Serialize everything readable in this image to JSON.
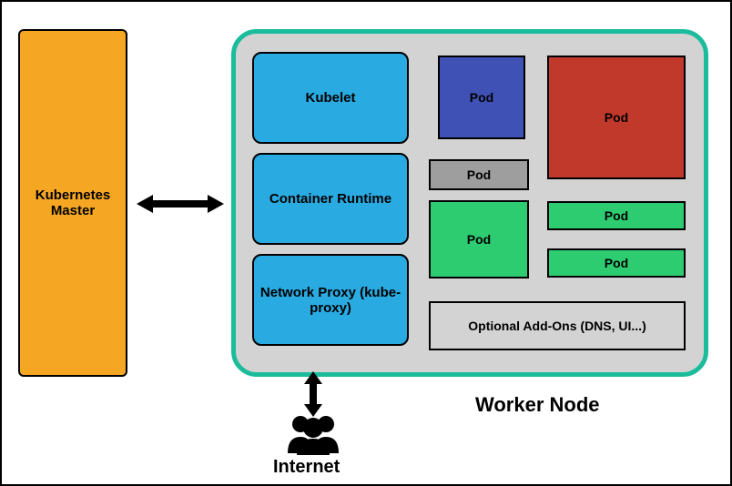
{
  "master": {
    "label": "Kubernetes Master"
  },
  "worker": {
    "label": "Worker Node",
    "core": [
      {
        "label": "Kubelet"
      },
      {
        "label": "Container Runtime"
      },
      {
        "label": "Network Proxy (kube-proxy)"
      }
    ],
    "pods": {
      "blue": "Pod",
      "red": "Pod",
      "gray": "Pod",
      "green1": "Pod",
      "green2": "Pod",
      "green3": "Pod"
    },
    "addon": "Optional Add-Ons (DNS, UI...)"
  },
  "internet": {
    "label": "Internet"
  }
}
